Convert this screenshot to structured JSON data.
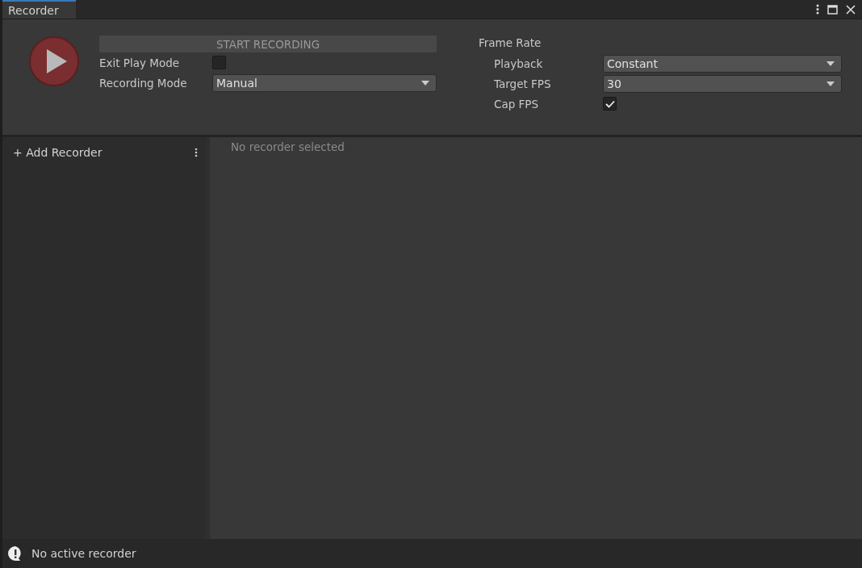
{
  "window": {
    "tab": "Recorder"
  },
  "record_controls": {
    "start_button": "START RECORDING",
    "fields": [
      {
        "kind": "checkbox",
        "label": "Exit Play Mode",
        "checked": false
      },
      {
        "kind": "dropdown",
        "label": "Recording Mode",
        "value": "Manual"
      }
    ]
  },
  "frame_rate": {
    "title": "Frame Rate",
    "fields": [
      {
        "kind": "dropdown",
        "label": "Playback",
        "value": "Constant"
      },
      {
        "kind": "dropdown",
        "label": "Target FPS",
        "value": "30"
      },
      {
        "kind": "checkbox",
        "label": "Cap FPS",
        "checked": true
      }
    ]
  },
  "recorder_list": {
    "add_button": "+ Add Recorder"
  },
  "details": {
    "message": "No recorder selected"
  },
  "status_bar": {
    "message": "No active recorder"
  }
}
